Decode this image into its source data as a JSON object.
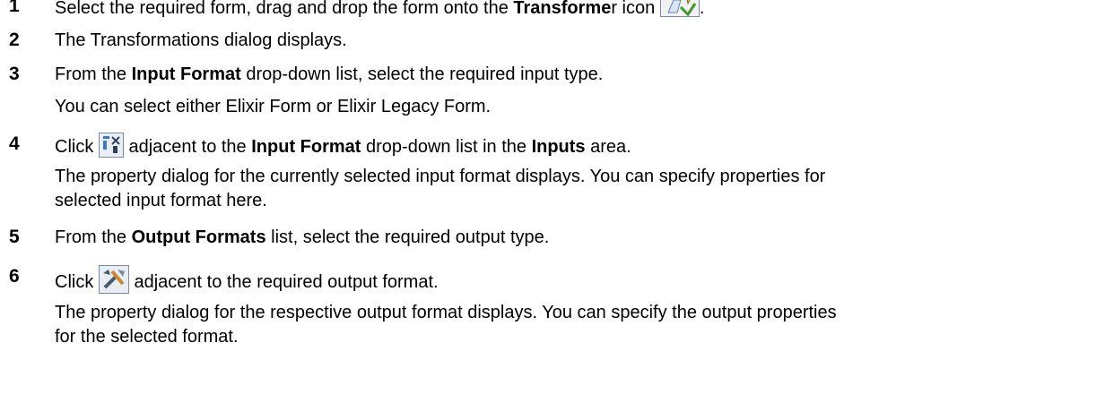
{
  "steps": [
    {
      "num": "1",
      "parts": [
        "Select the required form, drag and drop the form onto the ",
        "Transforme",
        "r icon",
        "."
      ],
      "icon": "transformer-icon"
    },
    {
      "num": "2",
      "text": "The Transformations dialog displays."
    },
    {
      "num": "3",
      "parts": [
        "From the ",
        "Input Format",
        " drop-down list, select the required input type."
      ],
      "sub": "You can select either Elixir Form or Elixir Legacy Form."
    },
    {
      "num": "4",
      "parts": [
        "Click",
        " adjacent to the ",
        "Input Format",
        " drop-down list in the ",
        "Inputs",
        " area."
      ],
      "icon": "input-properties-icon",
      "sub1": "The property dialog for the currently selected input format displays. You can specify properties for",
      "sub2": "selected input format here."
    },
    {
      "num": "5",
      "parts": [
        "From the ",
        "Output Formats",
        " list, select the required output type."
      ]
    },
    {
      "num": "6",
      "parts": [
        "Click",
        " adjacent to the required output format."
      ],
      "icon": "output-properties-icon",
      "sub1": "The property dialog for the respective output format displays. You can specify the output properties",
      "sub2": "for the selected format."
    }
  ]
}
